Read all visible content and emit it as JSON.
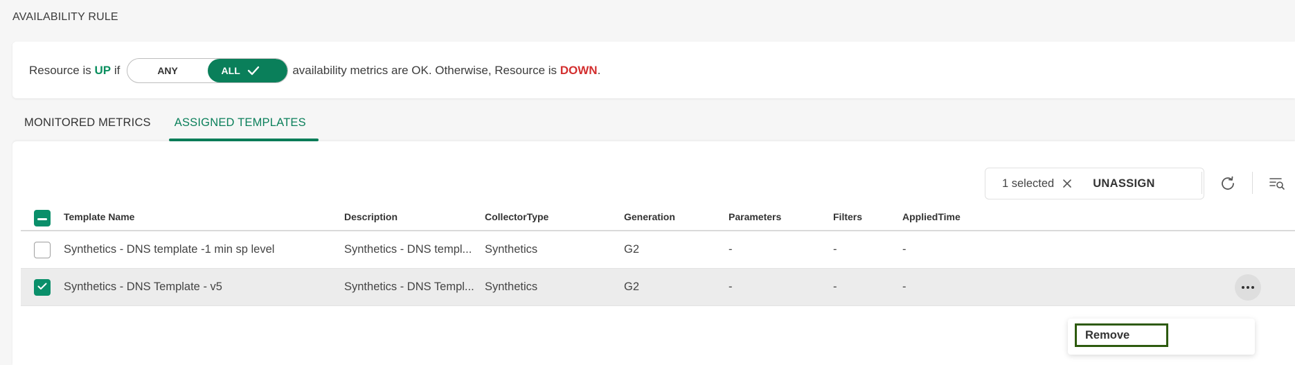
{
  "section": {
    "title": "AVAILABILITY RULE"
  },
  "rule": {
    "prefix": "Resource is ",
    "up": "UP",
    "if_text": " if",
    "toggle": {
      "any_label": "ANY",
      "all_label": "ALL",
      "selected": "ALL"
    },
    "middle": "availability metrics are OK. Otherwise, Resource is ",
    "down": "DOWN",
    "suffix": "."
  },
  "tabs": [
    {
      "label": "MONITORED METRICS",
      "active": false
    },
    {
      "label": "ASSIGNED TEMPLATES",
      "active": true
    }
  ],
  "selection": {
    "count_label": "1 selected",
    "unassign_label": "UNASSIGN"
  },
  "table": {
    "headers": [
      "Template Name",
      "Description",
      "CollectorType",
      "Generation",
      "Parameters",
      "Filters",
      "AppliedTime"
    ],
    "rows": [
      {
        "checked": false,
        "name": "Synthetics - DNS template -1 min sp level",
        "description": "Synthetics - DNS templ...",
        "collector": "Synthetics",
        "generation": "G2",
        "parameters": "-",
        "filters": "-",
        "applied": "-"
      },
      {
        "checked": true,
        "name": "Synthetics - DNS Template - v5",
        "description": "Synthetics - DNS Templ...",
        "collector": "Synthetics",
        "generation": "G2",
        "parameters": "-",
        "filters": "-",
        "applied": "-"
      }
    ]
  },
  "context_menu": {
    "items": [
      {
        "label": "Remove"
      }
    ]
  },
  "colors": {
    "brand_green": "#0a7f5a",
    "up_green": "#0a8f5f",
    "down_red": "#d32f2f",
    "focus_outline": "#2d5a0e"
  },
  "icons": [
    "check-icon",
    "close-icon",
    "refresh-icon",
    "filter-search-icon",
    "more-horizontal-icon",
    "checkbox-indeterminate-icon",
    "checkbox-checked-icon"
  ]
}
